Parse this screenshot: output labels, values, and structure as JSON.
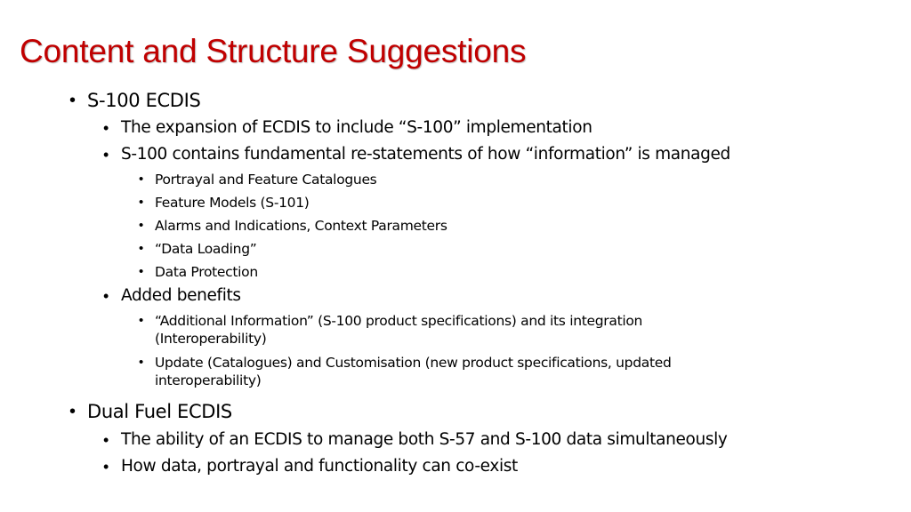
{
  "slide": {
    "title": "Content and Structure Suggestions",
    "title_color": "#c00000",
    "bullet_glyph": "•",
    "sections": [
      {
        "label": "S-100 ECDIS",
        "items": [
          {
            "label": "The expansion of ECDIS to include “S-100” implementation"
          },
          {
            "label": "S-100 contains fundamental re-statements of how “information” is managed",
            "items": [
              "Portrayal and Feature Catalogues",
              "Feature Models (S-101)",
              "Alarms and Indications, Context Parameters",
              "“Data Loading”",
              "Data Protection"
            ]
          },
          {
            "label": "Added benefits",
            "items": [
              [
                "“Additional Information” (S-100 product specifications) and its integration",
                "(Interoperability)"
              ],
              [
                "Update (Catalogues) and Customisation (new product specifications, updated",
                "interoperability)"
              ]
            ]
          }
        ]
      },
      {
        "label": "Dual Fuel ECDIS",
        "items": [
          {
            "label": "The ability of an ECDIS to manage both S-57 and S-100 data simultaneously"
          },
          {
            "label": "How data, portrayal and functionality can co-exist"
          }
        ]
      }
    ]
  }
}
